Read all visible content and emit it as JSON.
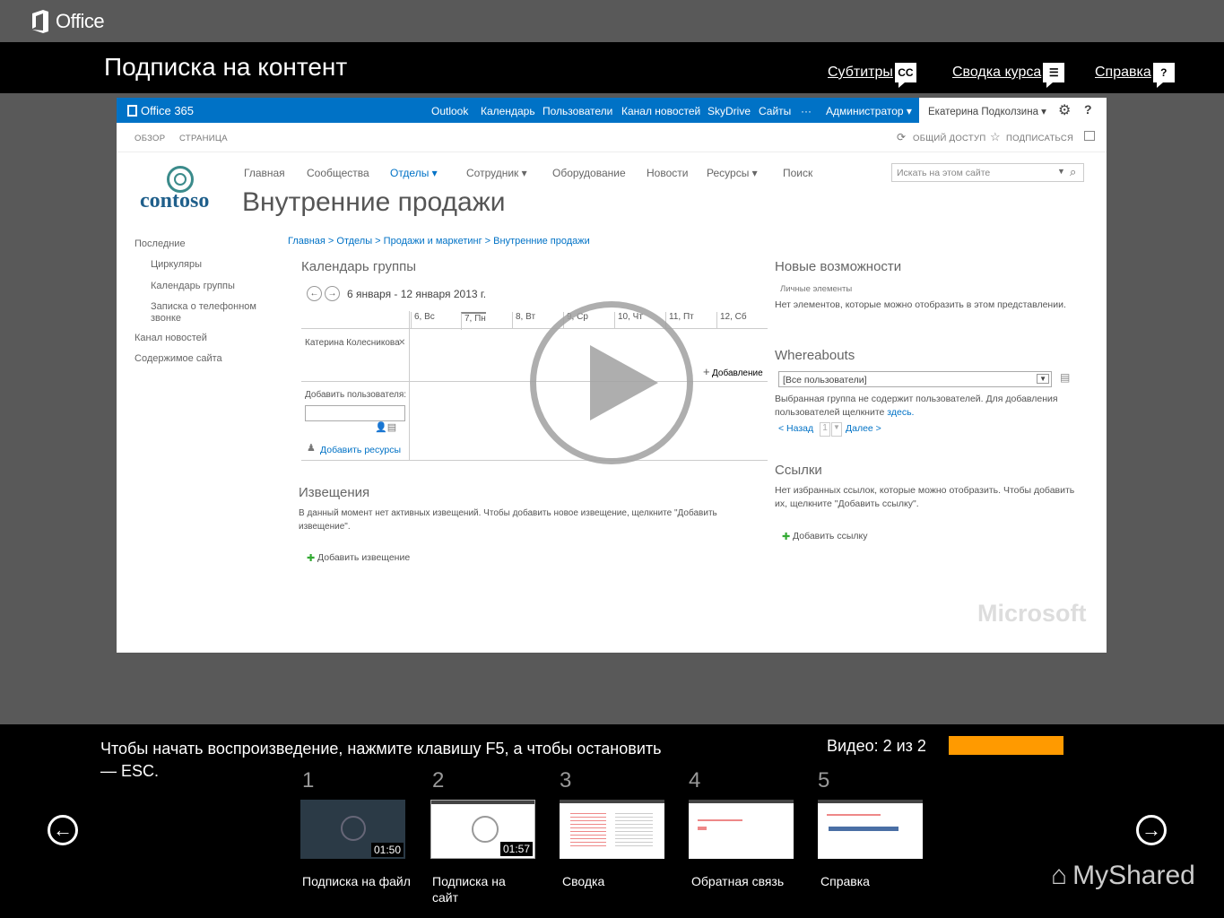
{
  "header": {
    "brand": "Office",
    "course_title": "Подписка на контент",
    "links": {
      "subtitles": "Субтитры",
      "subtitles_icon": "CC",
      "summary": "Сводка курса",
      "help": "Справка",
      "help_icon": "?"
    }
  },
  "video": {
    "suite": {
      "brand": "Office 365",
      "nav": [
        "Outlook",
        "Календарь",
        "Пользователи",
        "Канал новостей",
        "SkyDrive",
        "Сайты",
        "···",
        "Администратор ▾"
      ],
      "user": "Екатерина Подколзина ▾"
    },
    "ribbon": {
      "tabs": [
        "ОБЗОР",
        "СТРАНИЦА"
      ],
      "share": "ОБЩИЙ ДОСТУП",
      "follow": "ПОДПИСАТЬСЯ"
    },
    "site": {
      "logo": "contoso",
      "topnav": [
        "Главная",
        "Сообщества",
        "Отделы ▾",
        "Сотрудник ▾",
        "Оборудование",
        "Новости",
        "Ресурсы ▾",
        "Поиск"
      ],
      "search_placeholder": "Искать на этом сайте",
      "title": "Внутренние продажи",
      "breadcrumb": "Главная > Отделы > Продажи и маркетинг > Внутренние продажи"
    },
    "quicklaunch": [
      "Последние",
      "Циркуляры",
      "Календарь группы",
      "Записка о телефонном звонке",
      "Канал новостей",
      "Содержимое сайта"
    ],
    "calendar": {
      "heading": "Календарь группы",
      "range": "6 января - 12 января 2013 г.",
      "days": [
        "6, Вс",
        "7, Пн",
        "8, Вт",
        "9, Ср",
        "10, Чт",
        "11, Пт",
        "12, Сб"
      ],
      "person": "Катерина Колесникова",
      "add_event": "Добавление",
      "add_user_label": "Добавить пользователя:",
      "add_resources": "Добавить ресурсы"
    },
    "announcements": {
      "heading": "Извещения",
      "text": "В данный момент нет активных извещений. Чтобы добавить новое извещение, щелкните \"Добавить извещение\".",
      "add": "Добавить извещение"
    },
    "whatsnew": {
      "heading": "Новые возможности",
      "sub": "Личные элементы",
      "text": "Нет элементов, которые можно отобразить в этом представлении."
    },
    "whereabouts": {
      "heading": "Whereabouts",
      "select": "[Все пользователи]",
      "text": "Выбранная группа не содержит пользователей. Для добавления пользователей щелкните",
      "here": "здесь.",
      "back": "< Назад",
      "page": "1",
      "next": "Далее >"
    },
    "links": {
      "heading": "Ссылки",
      "text": "Нет избранных ссылок, которые можно отобразить. Чтобы добавить их, щелкните \"Добавить ссылку\".",
      "add": "Добавить ссылку"
    },
    "watermark": "Microsoft"
  },
  "bottom": {
    "instruction": "Чтобы начать воспроизведение, нажмите клавишу F5, а чтобы остановить — ESC.",
    "video_count": "Видео: 2 из 2",
    "progress": 1.0,
    "thumbs": [
      {
        "num": "1",
        "label": "Подписка на файл",
        "duration": "01:50"
      },
      {
        "num": "2",
        "label": "Подписка на сайт",
        "duration": "01:57"
      },
      {
        "num": "3",
        "label": "Сводка",
        "duration": ""
      },
      {
        "num": "4",
        "label": "Обратная связь",
        "duration": ""
      },
      {
        "num": "5",
        "label": "Справка",
        "duration": ""
      }
    ],
    "watermark": "MyShared"
  },
  "colors": {
    "accent": "#ff9a00",
    "suite": "#0072c6",
    "bar": "#000000",
    "stage": "#595959"
  }
}
